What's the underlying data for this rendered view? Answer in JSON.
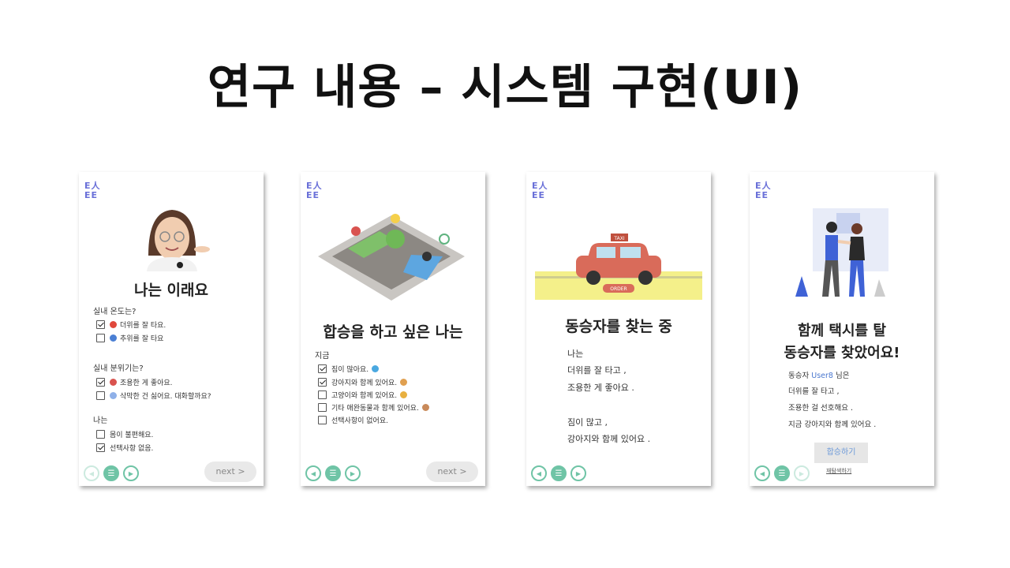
{
  "slide": {
    "title": "연구 내용 – 시스템 구현(UI)"
  },
  "logo": {
    "line1": "E人",
    "line2": "EE"
  },
  "cards": [
    {
      "heading": "나는 이래요",
      "groups": [
        {
          "question": "실내 온도는?",
          "options": [
            {
              "label": "더위를 잘 타요.",
              "checked": true,
              "emoji_color": "#e0483c",
              "icon": "hot-face-icon"
            },
            {
              "label": "추위를 잘 타요",
              "checked": false,
              "emoji_color": "#4a7fd4",
              "icon": "cold-face-icon"
            }
          ]
        },
        {
          "question": "실내 분위기는?",
          "options": [
            {
              "label": "조용한 게 좋아요.",
              "checked": true,
              "emoji_color": "#d9534f",
              "icon": "mute-icon"
            },
            {
              "label": "삭막한 건 싫어요. 대화할까요?",
              "checked": false,
              "emoji_color": "#8fb0e8",
              "icon": "speaker-icon"
            }
          ]
        },
        {
          "question": "나는",
          "options": [
            {
              "label": "몸이 불편해요.",
              "checked": false
            },
            {
              "label": "선택사항 없음.",
              "checked": true
            }
          ]
        }
      ],
      "next_label": "next >"
    },
    {
      "heading": "합승을 하고 싶은 나는",
      "question": "지금",
      "options": [
        {
          "label": "짐이 많아요.",
          "checked": true,
          "emoji_color": "#4aa8e0",
          "icon": "luggage-icon"
        },
        {
          "label": "강아지와 함께 있어요.",
          "checked": true,
          "emoji_color": "#e0a050",
          "icon": "dog-icon"
        },
        {
          "label": "고양이와 함께 있어요.",
          "checked": false,
          "emoji_color": "#e8b040",
          "icon": "cat-icon"
        },
        {
          "label": "기타 애완동물과 함께 있어요.",
          "checked": false,
          "emoji_color": "#c98a5a",
          "icon": "pets-icon"
        },
        {
          "label": "선택사항이 없어요.",
          "checked": false
        }
      ],
      "next_label": "next >"
    },
    {
      "heading": "동승자를 찾는 중",
      "taxi_sign": "TAXI",
      "order_label": "ORDER",
      "lines": [
        "나는",
        "더위를 잘 타고 ,",
        "조용한 게 좋아요 .",
        "짐이 많고 ,",
        "강아지와 함께 있어요 ."
      ]
    },
    {
      "heading_line1": "함께 택시를 탈",
      "heading_line2": "동승자를 찾았어요!",
      "intro_prefix": "동승자 ",
      "user": "User8",
      "intro_suffix": " 님은",
      "lines": [
        "더위를 잘 타고 ,",
        "조용한 걸 선호해요 .",
        "지금 강아지와 함께 있어요 ."
      ],
      "apply_label": "합승하기",
      "rescan_label": "재탐색하기"
    }
  ],
  "colors": {
    "accent": "#6fc4a6",
    "logo": "#6a70d8",
    "link": "#4b78cf"
  }
}
